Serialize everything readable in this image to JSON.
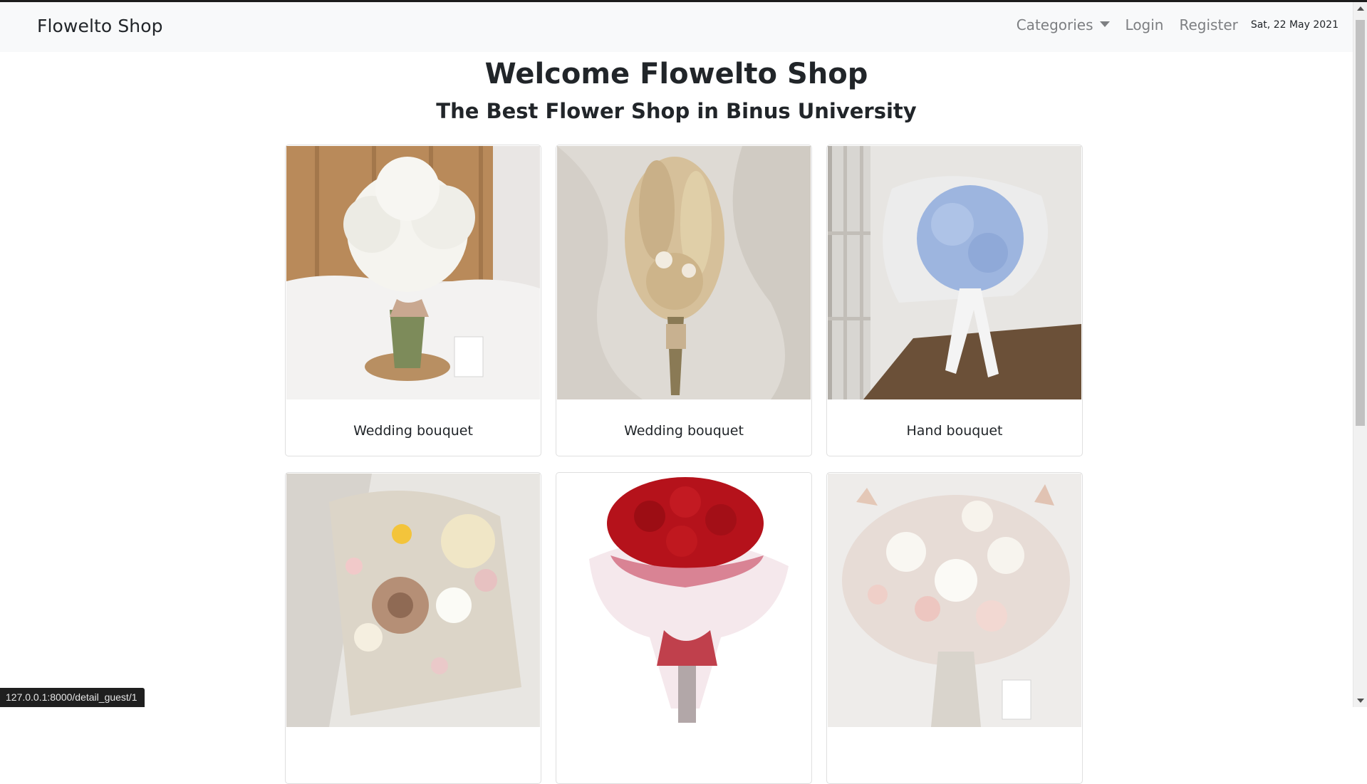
{
  "navbar": {
    "brand": "Flowelto Shop",
    "categories_label": "Categories",
    "login_label": "Login",
    "register_label": "Register",
    "date": "Sat, 22 May 2021"
  },
  "hero": {
    "title": "Welcome Flowelto Shop",
    "subtitle": "The Best Flower Shop in Binus University"
  },
  "products": [
    {
      "name": "Wedding bouquet",
      "image": "baby-breath-bouquet-photo"
    },
    {
      "name": "Wedding bouquet",
      "image": "dried-wheat-bouquet-photo"
    },
    {
      "name": "Hand bouquet",
      "image": "blue-hydrangea-bouquet-photo"
    },
    {
      "name": "",
      "image": "dried-flower-mix-bouquet-photo"
    },
    {
      "name": "",
      "image": "red-rose-bouquet-photo"
    },
    {
      "name": "",
      "image": "white-rose-pampas-bouquet-photo"
    }
  ],
  "status_bar": {
    "url": "127.0.0.1:8000/detail_guest/1"
  },
  "colors": {
    "navbar_bg": "#f8f9fa",
    "nav_link": "#7d7f82",
    "text": "#212529",
    "card_border": "#dfdfdf"
  }
}
